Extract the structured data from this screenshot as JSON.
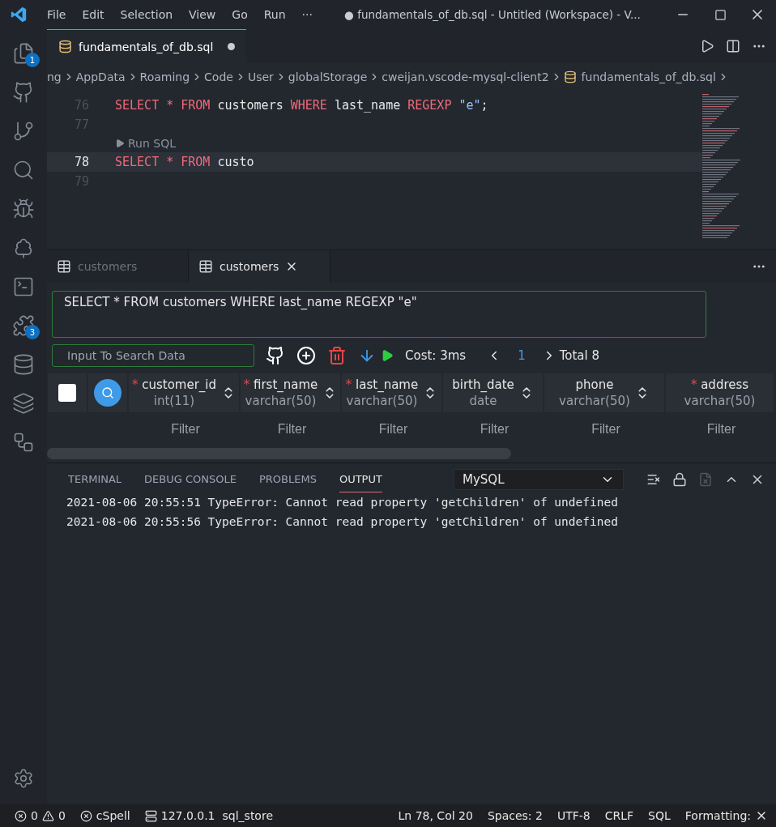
{
  "menu": [
    "File",
    "Edit",
    "Selection",
    "View",
    "Go",
    "Run",
    "···"
  ],
  "window": {
    "title": "● fundamentals_of_db.sql - Untitled (Workspace) - V..."
  },
  "activity_bar": [
    {
      "kind": "files",
      "badge": "1"
    },
    {
      "kind": "github"
    },
    {
      "kind": "branch"
    },
    {
      "kind": "search"
    },
    {
      "kind": "bug"
    },
    {
      "kind": "tree"
    },
    {
      "kind": "terminal"
    },
    {
      "kind": "puzzle",
      "badge": "3"
    },
    {
      "kind": "database"
    },
    {
      "kind": "layers"
    },
    {
      "kind": "nodes"
    }
  ],
  "editor_tabs": [
    {
      "label": "fundamentals_of_db.sql",
      "modified": true,
      "selected": true
    }
  ],
  "breadcrumb": [
    {
      "text": "ng"
    },
    {
      "text": "AppData"
    },
    {
      "text": "Roaming"
    },
    {
      "text": "Code"
    },
    {
      "text": "User"
    },
    {
      "text": "globalStorage"
    },
    {
      "text": "cweijan.vscode-mysql-client2"
    },
    {
      "text": "fundamentals_of_db.sql",
      "file": true
    }
  ],
  "code_lines": [
    {
      "number": "76",
      "current": false,
      "tokens": [
        {
          "kind": "kw",
          "text": "SELECT"
        },
        {
          "kind": "kw",
          "text": " * "
        },
        {
          "kind": "kw",
          "text": "FROM"
        },
        {
          "kind": "id",
          "text": " customers "
        },
        {
          "kind": "kw",
          "text": "WHERE"
        },
        {
          "kind": "id",
          "text": " last_name "
        },
        {
          "kind": "kw",
          "text": "REGEXP"
        },
        {
          "kind": "str",
          "text": " \"e\""
        },
        {
          "kind": "id",
          "text": ";"
        }
      ]
    },
    {
      "number": "77",
      "current": false
    },
    {
      "number": "78",
      "current": true,
      "codelens": "Run SQL",
      "tokens": [
        {
          "kind": "kw",
          "text": "SELECT"
        },
        {
          "kind": "kw",
          "text": " * "
        },
        {
          "kind": "kw",
          "text": "FROM"
        },
        {
          "kind": "id",
          "text": " custo"
        }
      ]
    },
    {
      "number": "79",
      "current": false
    }
  ],
  "select_all": {
    "checked": false
  },
  "result_tabs": [
    {
      "label": "customers",
      "selected": false
    },
    {
      "label": "customers",
      "selected": true
    }
  ],
  "query": "SELECT * FROM customers WHERE last_name REGEXP \"e\"",
  "search": {
    "placeholder": "Input To Search Data"
  },
  "toolbar": {
    "cost": "Cost: 3ms",
    "page": "1",
    "total": "Total 8"
  },
  "columns": [
    {
      "name": "customer_id",
      "type": "int(11)",
      "required": true
    },
    {
      "name": "first_name",
      "type": "varchar(50)",
      "required": true
    },
    {
      "name": "last_name",
      "type": "varchar(50)",
      "required": true
    },
    {
      "name": "birth_date",
      "type": "date",
      "required": false
    },
    {
      "name": "phone",
      "type": "varchar(50)",
      "required": false
    },
    {
      "name": "address",
      "type": "varchar(50)",
      "required": true
    }
  ],
  "filters": [
    {
      "placeholder": "Filter"
    },
    {
      "placeholder": "Filter"
    },
    {
      "placeholder": "Filter"
    },
    {
      "placeholder": "Filter"
    },
    {
      "placeholder": "Filter"
    },
    {
      "placeholder": "Filter"
    }
  ],
  "panel_tabs": [
    {
      "label": "TERMINAL",
      "selected": false
    },
    {
      "label": "DEBUG CONSOLE",
      "selected": false
    },
    {
      "label": "PROBLEMS",
      "selected": false
    },
    {
      "label": "OUTPUT",
      "selected": true
    }
  ],
  "output_channel": "MySQL",
  "output_lines": [
    "2021-08-06 20:55:51 TypeError: Cannot read property 'getChildren' of undefined",
    "2021-08-06 20:55:56 TypeError: Cannot read property 'getChildren' of undefined"
  ],
  "status_bar": {
    "errors": "0",
    "warnings": "0",
    "spell": "cSpell",
    "host": "127.0.0.1",
    "database": "sql_store",
    "right": [
      "Ln 78, Col 20",
      "Spaces: 2",
      "UTF-8",
      "CRLF",
      "SQL"
    ],
    "formatting": "Formatting:"
  }
}
